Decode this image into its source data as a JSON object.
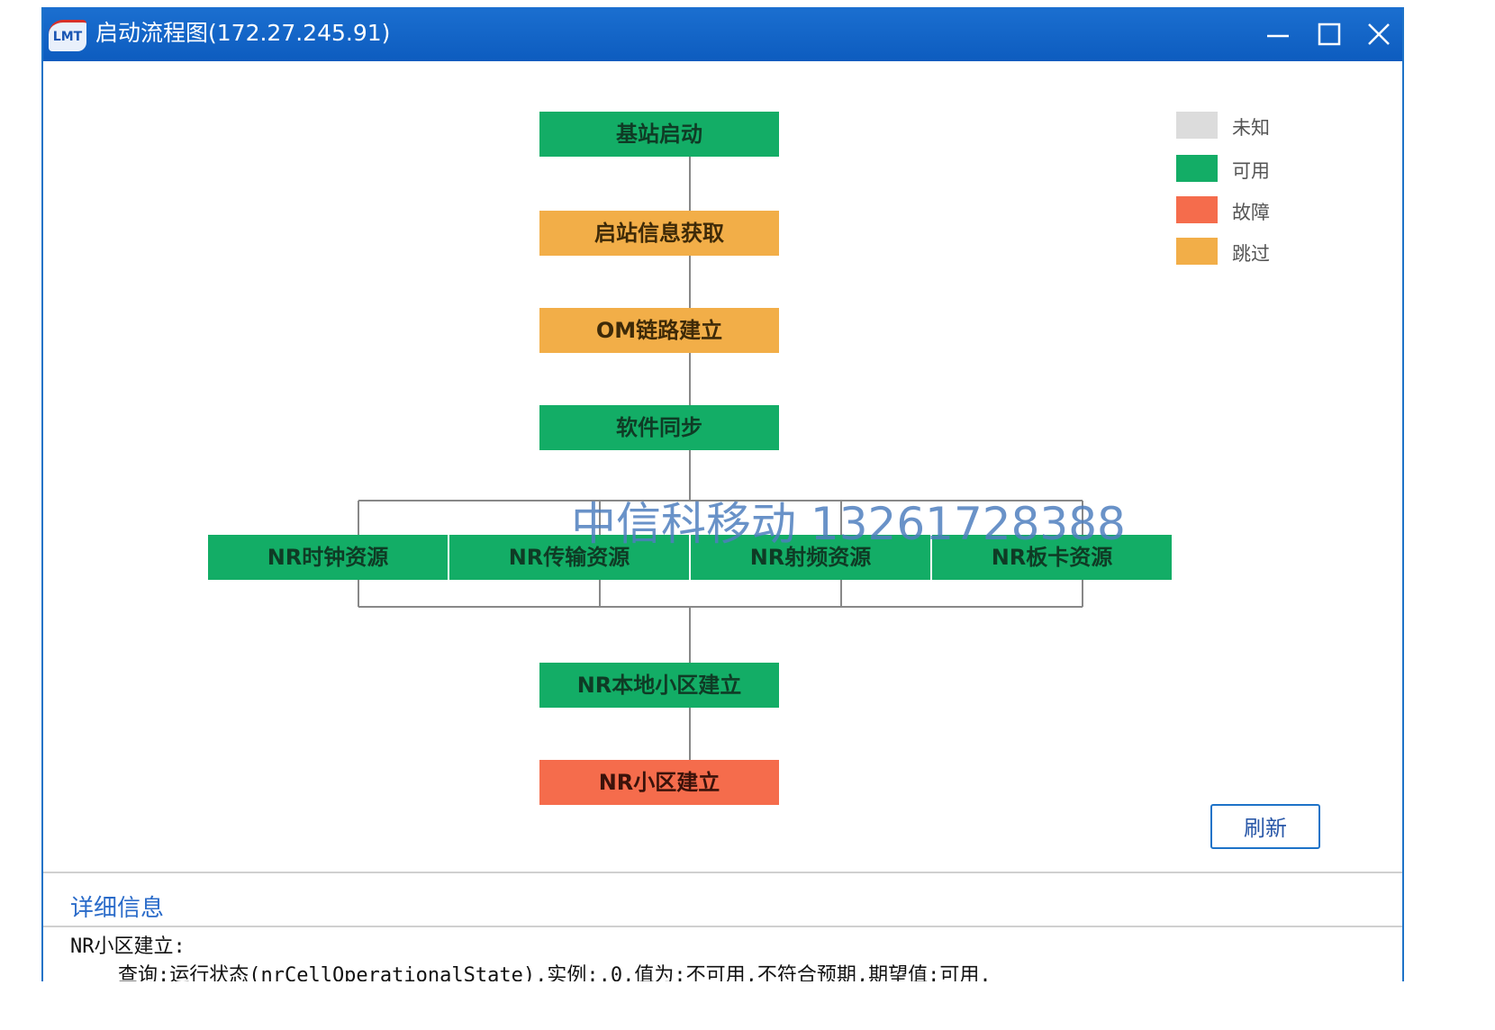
{
  "window": {
    "app_logo": "LMT",
    "title": "启动流程图(172.27.245.91)",
    "controls": [
      "minimize-icon",
      "maximize-icon",
      "close-icon"
    ]
  },
  "flow": {
    "nodes": [
      {
        "label": "基站启动",
        "status": "可用"
      },
      {
        "label": "启站信息获取",
        "status": "跳过"
      },
      {
        "label": "OM链路建立",
        "status": "跳过"
      },
      {
        "label": "软件同步",
        "status": "可用"
      },
      {
        "label": "NR时钟资源",
        "status": "可用"
      },
      {
        "label": "NR传输资源",
        "status": "可用"
      },
      {
        "label": "NR射频资源",
        "status": "可用"
      },
      {
        "label": "NR板卡资源",
        "status": "可用"
      },
      {
        "label": "NR本地小区建立",
        "status": "可用"
      },
      {
        "label": "NR小区建立",
        "status": "故障"
      }
    ]
  },
  "legend": [
    {
      "label": "未知",
      "color": "#dcdcdc"
    },
    {
      "label": "可用",
      "color": "#13ad66"
    },
    {
      "label": "故障",
      "color": "#f56c4c"
    },
    {
      "label": "跳过",
      "color": "#f2ae48"
    }
  ],
  "refresh_label": "刷新",
  "details": {
    "title": "详细信息",
    "line1": "NR小区建立:",
    "line2": "    查询:运行状态(nrCellOperationalState),实例:.0,值为:不可用,不符合预期,期望值:可用."
  },
  "watermark": "中信科移动 13261728388"
}
